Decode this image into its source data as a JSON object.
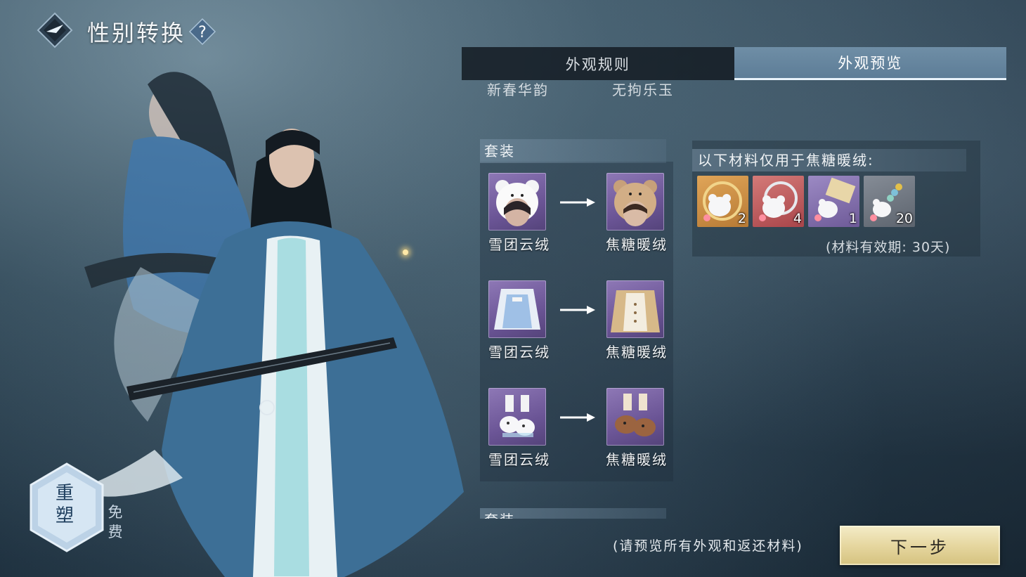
{
  "header": {
    "title": "性别转换",
    "help_icon": "question-mark-icon"
  },
  "tabs": [
    {
      "label": "外观规则",
      "active": false
    },
    {
      "label": "外观预览",
      "active": true
    }
  ],
  "list": {
    "cutoff_row": {
      "from_label": "新春华韵",
      "to_label": "无拘乐玉"
    },
    "section_title": "套装",
    "items": [
      {
        "from_label": "雪团云绒",
        "to_label": "焦糖暖绒",
        "icon": "hat-icon"
      },
      {
        "from_label": "雪团云绒",
        "to_label": "焦糖暖绒",
        "icon": "outfit-icon"
      },
      {
        "from_label": "雪团云绒",
        "to_label": "焦糖暖绒",
        "icon": "shoes-icon"
      }
    ],
    "next_section_title": "套装"
  },
  "materials": {
    "heading": "以下材料仅用于焦糖暖绒:",
    "slots": [
      {
        "count": "2",
        "icon": "hood-ring-icon",
        "rarity_color": "#c98a3c"
      },
      {
        "count": "4",
        "icon": "hood-ring-icon",
        "rarity_color": "#c0595c"
      },
      {
        "count": "1",
        "icon": "scroll-icon",
        "rarity_color": "#7e6aa8"
      },
      {
        "count": "20",
        "icon": "beads-icon",
        "rarity_color": "#6e7580"
      }
    ],
    "validity": "(材料有效期: 30天)"
  },
  "footer": {
    "hint": "(请预览所有外观和返还材料)",
    "next_label": "下一步",
    "reshape_label": "重塑",
    "free_label": "免费"
  },
  "colors": {
    "accent_tab": "#5d7d97",
    "next_button": "#e6d7a0",
    "item_frame_purple": "#6b5596"
  }
}
